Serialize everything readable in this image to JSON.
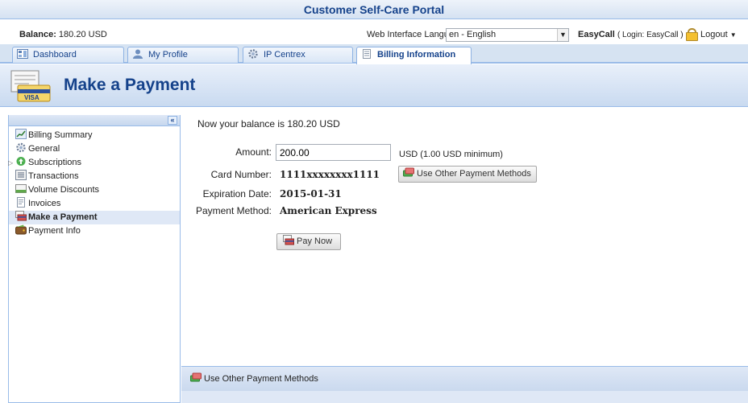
{
  "window": {
    "title": "Customer Self-Care Portal"
  },
  "infobar": {
    "balance_label": "Balance:",
    "balance_value": "180.20 USD",
    "language_label": "Web Interface Language:",
    "language_value": "en - English",
    "user_name": "EasyCall",
    "user_login": "( Login: EasyCall )",
    "logout_label": "Logout"
  },
  "tabs": [
    {
      "label": "Dashboard",
      "icon": "dashboard-icon"
    },
    {
      "label": "My Profile",
      "icon": "user-icon"
    },
    {
      "label": "IP Centrex",
      "icon": "gear-icon"
    },
    {
      "label": "Billing Information",
      "icon": "document-icon",
      "active": true
    }
  ],
  "header": {
    "title": "Make a Payment"
  },
  "sidebar": {
    "collapse": "«",
    "items": [
      {
        "label": "Billing Summary",
        "icon": "chart-icon"
      },
      {
        "label": "General",
        "icon": "gear-icon"
      },
      {
        "label": "Subscriptions",
        "icon": "subscriptions-icon",
        "expandable": true
      },
      {
        "label": "Transactions",
        "icon": "list-icon"
      },
      {
        "label": "Volume Discounts",
        "icon": "discount-icon"
      },
      {
        "label": "Invoices",
        "icon": "invoice-icon"
      },
      {
        "label": "Make a Payment",
        "icon": "payment-card-icon",
        "selected": true
      },
      {
        "label": "Payment Info",
        "icon": "wallet-icon"
      }
    ]
  },
  "content": {
    "balance_text": "Now your balance is 180.20 USD",
    "amount_label": "Amount:",
    "amount_value": "200.00",
    "amount_hint": "USD (1.00 USD minimum)",
    "card_number_label": "Card Number:",
    "card_number_value": "1111xxxxxxxx1111",
    "expiration_label": "Expiration Date:",
    "expiration_value": "2015-01-31",
    "payment_method_label": "Payment Method:",
    "payment_method_value": "American Express",
    "other_methods_button": "Use Other Payment Methods",
    "pay_now_button": "Pay Now"
  },
  "footer": {
    "other_methods_link": "Use Other Payment Methods"
  },
  "colors": {
    "accent": "#15428b",
    "border": "#99bbe8",
    "panel": "#dfe8f6"
  }
}
